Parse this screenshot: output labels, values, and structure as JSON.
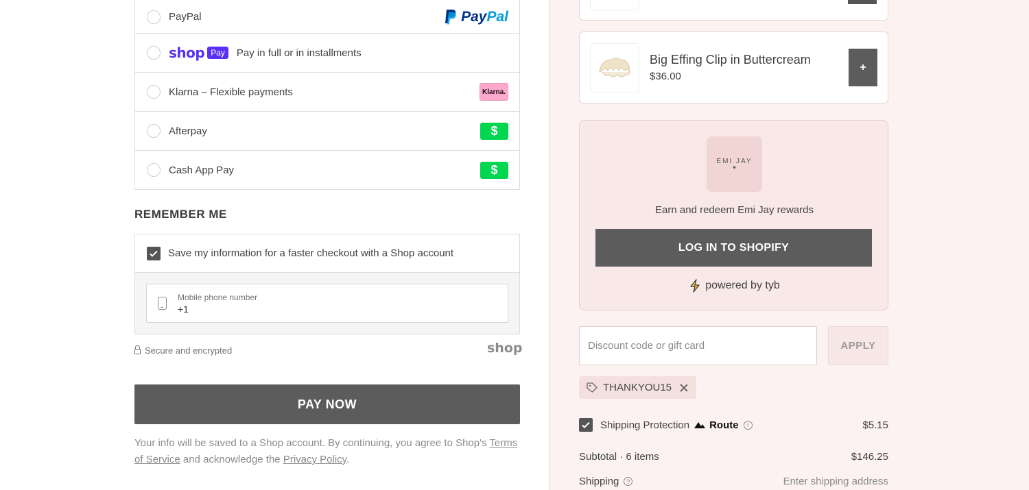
{
  "payment_methods": [
    {
      "label": "PayPal",
      "logo_parts": [
        "Pay",
        "Pal"
      ]
    },
    {
      "shop_logo": "shop",
      "badge": "Pay",
      "label": "Pay in full or in installments"
    },
    {
      "label": "Klarna – Flexible payments",
      "badge": "Klarna."
    },
    {
      "label": "Afterpay",
      "badge": "$"
    },
    {
      "label": "Cash App Pay",
      "badge": "$"
    }
  ],
  "remember_me": {
    "title": "REMEMBER ME",
    "checkbox_label": "Save my information for a faster checkout with a Shop account",
    "phone_label": "Mobile phone number",
    "phone_value": "+1"
  },
  "secure_text": "Secure and encrypted",
  "shop_footer_logo": "shop",
  "pay_now_label": "PAY NOW",
  "legal": {
    "text1": "Your info will be saved to a Shop account. By continuing, you agree to Shop's ",
    "terms_link": "Terms of Service",
    "text2": " and acknowledge the ",
    "privacy_link": "Privacy Policy",
    "text3": "."
  },
  "product": {
    "name": "Big Effing Clip in Buttercream",
    "price": "$36.00",
    "add_label": "+"
  },
  "rewards": {
    "logo_text": "EMI JAY",
    "logo_heart": "♥",
    "text": "Earn and redeem Emi Jay rewards",
    "login_label": "LOG IN TO SHOPIFY",
    "powered_text": "powered by tyb"
  },
  "discount": {
    "placeholder": "Discount code or gift card",
    "apply_label": "APPLY",
    "applied_code": "THANKYOU15"
  },
  "shipping_protection": {
    "label": "Shipping Protection",
    "brand": "Route",
    "info": "i",
    "price": "$5.15"
  },
  "subtotal": {
    "label": "Subtotal · 6 items",
    "value": "$146.25"
  },
  "shipping": {
    "label": "Shipping",
    "help": "?",
    "value": "Enter shipping address"
  },
  "colors": {
    "accent": "#5c5c5c",
    "sidebar_bg": "#fbf2f1",
    "shop_purple": "#5a31f4",
    "klarna_pink": "#ffa8cd",
    "cashapp_green": "#00d64f"
  }
}
